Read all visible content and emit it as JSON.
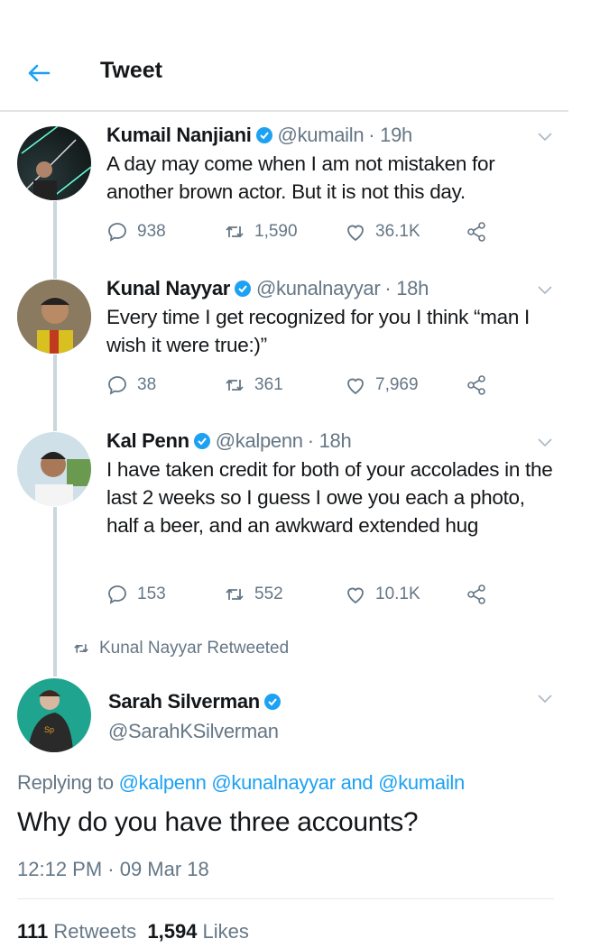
{
  "header": {
    "title": "Tweet",
    "back_icon": "arrow-left-icon"
  },
  "colors": {
    "accent": "#1da1f2",
    "muted": "#657786",
    "text": "#14171a"
  },
  "thread": [
    {
      "name": "Kumail Nanjiani",
      "handle": "@kumailn",
      "time": "· 19h",
      "text": "A day may come when I am not mistaken for another brown actor. But it is not this day.",
      "replies": "938",
      "retweets": "1,590",
      "likes": "36.1K"
    },
    {
      "name": "Kunal Nayyar",
      "handle": "@kunalnayyar",
      "time": "· 18h",
      "text": "Every time I get recognized for you I think “man I wish it were true:)”",
      "replies": "38",
      "retweets": "361",
      "likes": "7,969"
    },
    {
      "name": "Kal Penn",
      "handle": "@kalpenn",
      "time": "· 18h",
      "text": "I have taken credit for both of your accolades in the last 2 weeks so I guess I owe you each a photo, half a beer, and an awkward extended hug",
      "replies": "153",
      "retweets": "552",
      "likes": "10.1K"
    }
  ],
  "retweeted_by": "Kunal Nayyar Retweeted",
  "main": {
    "name": "Sarah Silverman",
    "handle": "@SarahKSilverman",
    "replying_prefix": "Replying to",
    "replying_1": "@kalpenn",
    "replying_2": "@kunalnayyar",
    "replying_and": "and",
    "replying_3": "@kumailn",
    "text": "Why do you have three accounts?",
    "timestamp": "12:12 PM · 09 Mar 18",
    "retweets_count": "111",
    "retweets_label": "Retweets",
    "likes_count": "1,594",
    "likes_label": "Likes"
  }
}
